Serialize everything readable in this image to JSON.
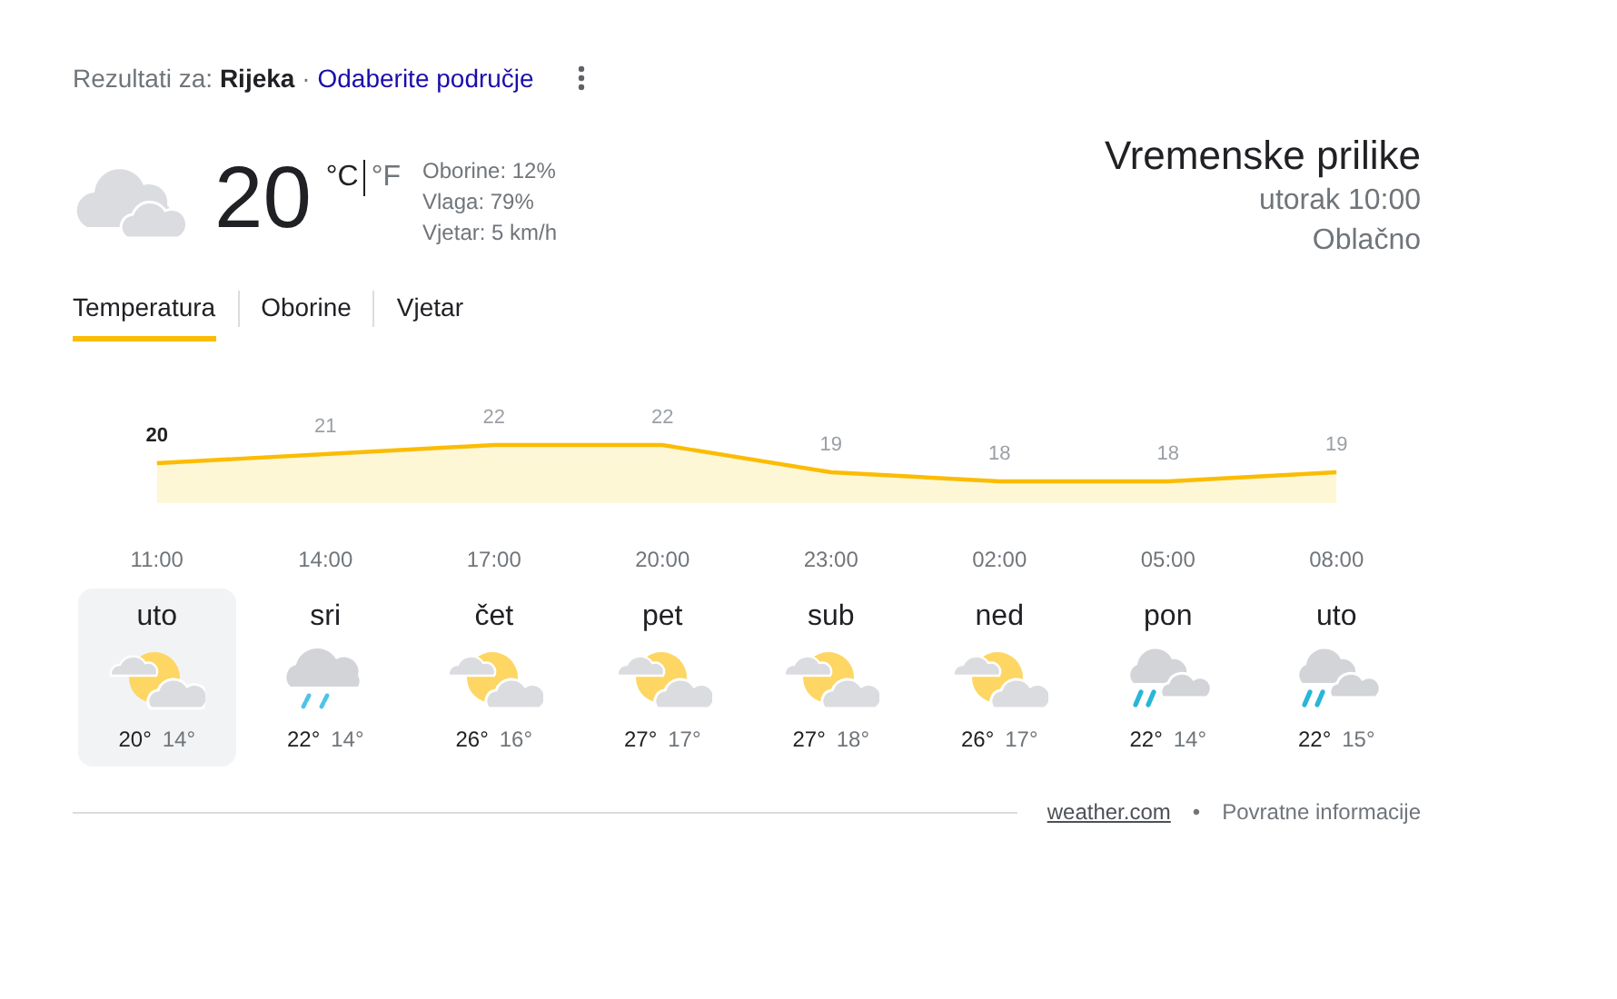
{
  "header": {
    "results_for": "Rezultati za: **Rijeka** ·",
    "change_area_link": "Odaberite područje"
  },
  "current": {
    "temperature": "20",
    "units": [
      {
        "label": "°C",
        "selected": true
      },
      {
        "label": "°F",
        "selected": false
      }
    ],
    "details": [
      "Oborine: 12%",
      "Vlaga: 79%",
      "Vjetar: 5 km/h"
    ]
  },
  "summary": {
    "title": "Vremenske prilike",
    "time": "utorak 10:00",
    "condition": "Oblačno"
  },
  "tabs": [
    {
      "label": "Temperatura",
      "selected": true
    },
    {
      "label": "Oborine",
      "selected": false
    },
    {
      "label": "Vjetar",
      "selected": false
    }
  ],
  "chart_data": {
    "type": "area",
    "categories": [
      "11:00",
      "14:00",
      "17:00",
      "20:00",
      "23:00",
      "02:00",
      "05:00",
      "08:00"
    ],
    "series": [
      {
        "color": "#fbbc04",
        "values": [
          20,
          21,
          22,
          22,
          19,
          18,
          18,
          19
        ]
      }
    ],
    "data_labels": true
  },
  "days": [
    {
      "day": "uto",
      "kind": "sunny",
      "high": "20°",
      "low": "14°",
      "selected": true
    },
    {
      "day": "sri",
      "kind": "rain",
      "high": "22°",
      "low": "14°",
      "selected": false
    },
    {
      "day": "čet",
      "kind": "sunny",
      "high": "26°",
      "low": "16°",
      "selected": false
    },
    {
      "day": "pet",
      "kind": "sunny",
      "high": "27°",
      "low": "17°",
      "selected": false
    },
    {
      "day": "sub",
      "kind": "sunny",
      "high": "27°",
      "low": "18°",
      "selected": false
    },
    {
      "day": "ned",
      "kind": "sunny",
      "high": "26°",
      "low": "17°",
      "selected": false
    },
    {
      "day": "pon",
      "kind": "showers",
      "high": "22°",
      "low": "14°",
      "selected": false
    },
    {
      "day": "uto",
      "kind": "showers",
      "high": "22°",
      "low": "15°",
      "selected": false
    }
  ],
  "footer": {
    "source_link": "weather.com",
    "separator": "•",
    "feedback_link": "Povratne informacije"
  }
}
